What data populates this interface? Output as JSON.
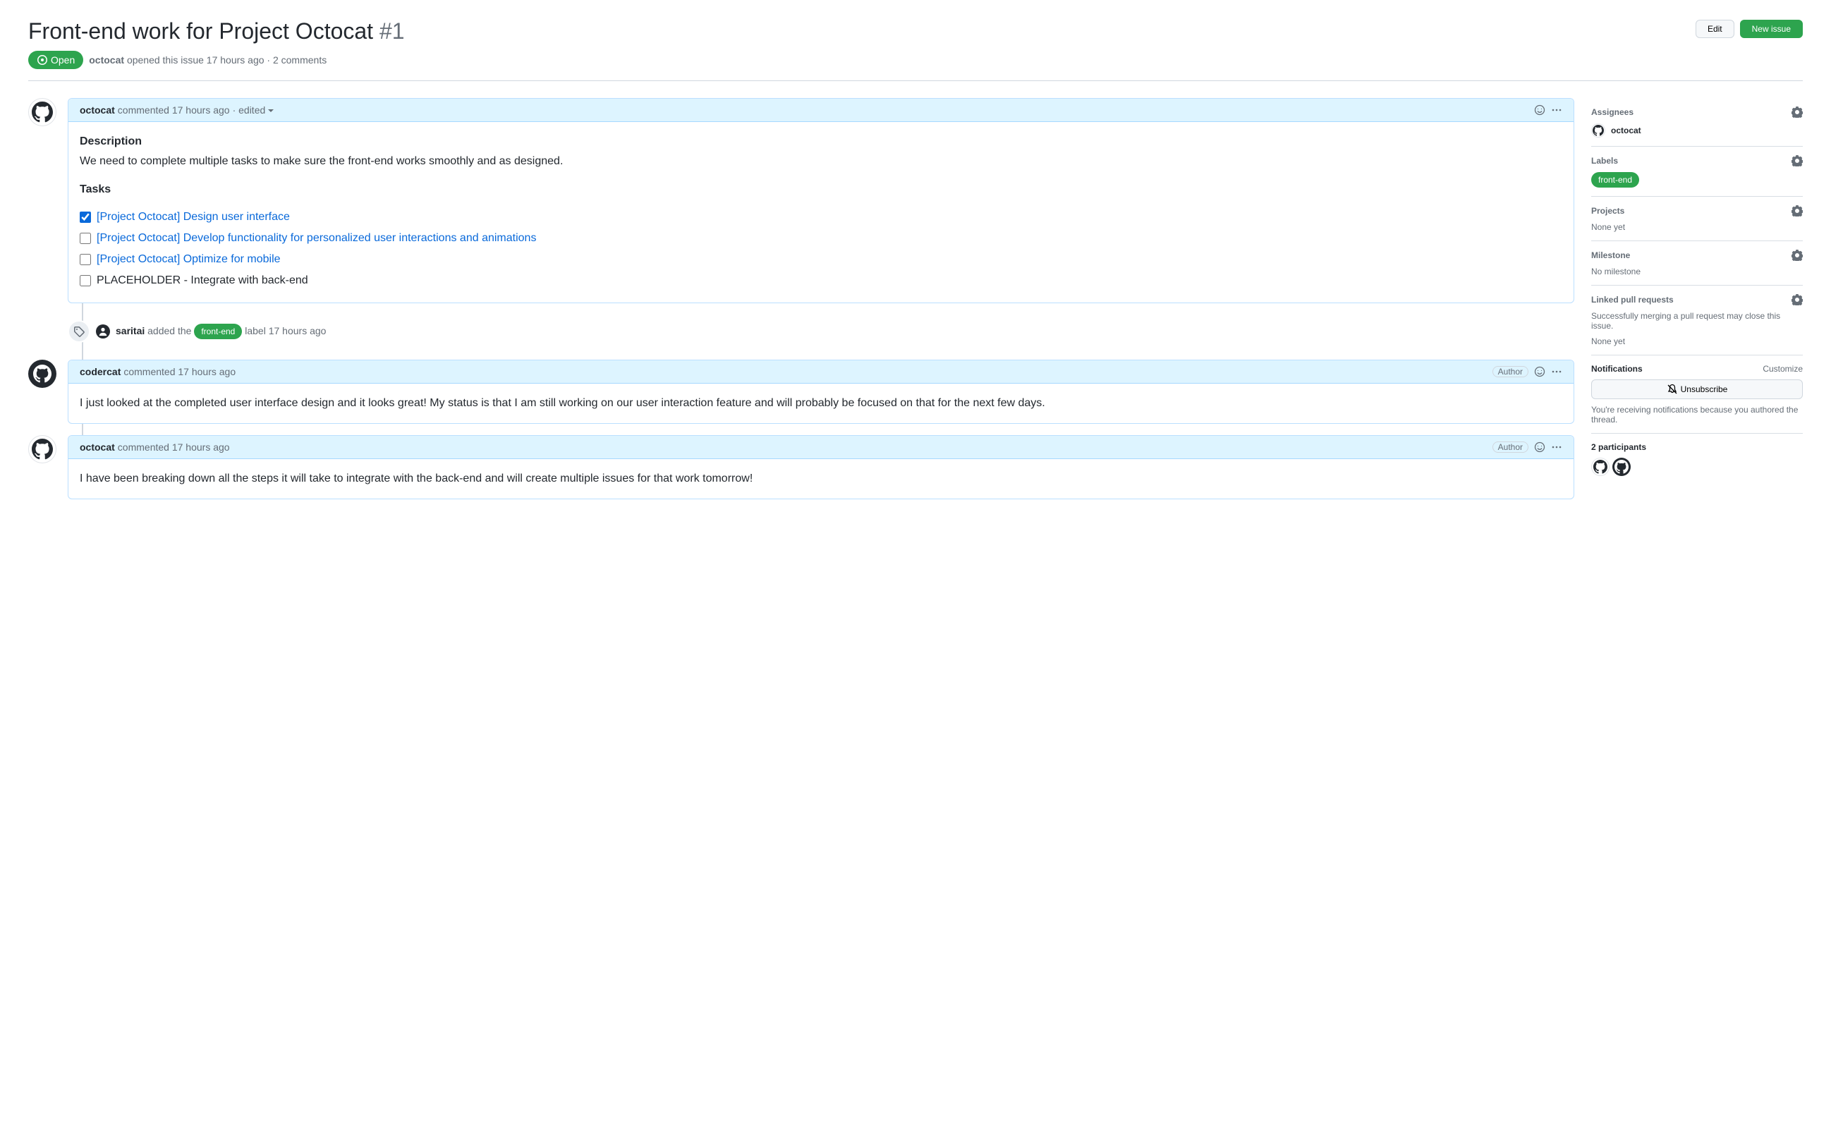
{
  "issue": {
    "title": "Front-end work for Project Octocat",
    "number": "#1",
    "state": "Open",
    "author": "octocat",
    "opened_text": "opened this issue 17 hours ago · 2 comments"
  },
  "actions": {
    "edit": "Edit",
    "new_issue": "New issue"
  },
  "comments": [
    {
      "author": "octocat",
      "timestamp": "commented 17 hours ago",
      "edited": "edited",
      "avatar_type": "octocat",
      "highlight": true,
      "show_author_badge": false,
      "body_type": "tasks",
      "desc_heading": "Description",
      "desc_text": "We need to complete multiple tasks to make sure the front-end works smoothly and as designed.",
      "tasks_heading": "Tasks",
      "tasks": [
        {
          "checked": true,
          "text": "[Project Octocat] Design user interface",
          "link": true
        },
        {
          "checked": false,
          "text": "[Project Octocat] Develop functionality for personalized user interactions and animations",
          "link": true
        },
        {
          "checked": false,
          "text": "[Project Octocat] Optimize for mobile",
          "link": true
        },
        {
          "checked": false,
          "text": "PLACEHOLDER - Integrate with back-end",
          "link": false
        }
      ]
    },
    {
      "author": "codercat",
      "timestamp": "commented 17 hours ago",
      "avatar_type": "codercat",
      "highlight": true,
      "show_author_badge": true,
      "author_badge": "Author",
      "body_type": "text",
      "body_text": "I just looked at the completed user interface design and it looks great! My status is that I am still working on our user interaction feature and will probably be focused on that for the next few days."
    },
    {
      "author": "octocat",
      "timestamp": "commented 17 hours ago",
      "avatar_type": "octocat",
      "highlight": true,
      "show_author_badge": true,
      "author_badge": "Author",
      "body_type": "text",
      "body_text": "I have been breaking down all the steps it will take to integrate with the back-end and will create multiple issues for that work tomorrow!"
    }
  ],
  "event": {
    "actor": "saritai",
    "text_before": "added the",
    "label": "front-end",
    "text_after": "label 17 hours ago"
  },
  "sidebar": {
    "assignees": {
      "title": "Assignees",
      "value": "octocat"
    },
    "labels": {
      "title": "Labels",
      "value": "front-end"
    },
    "projects": {
      "title": "Projects",
      "value": "None yet"
    },
    "milestone": {
      "title": "Milestone",
      "value": "No milestone"
    },
    "linked_prs": {
      "title": "Linked pull requests",
      "desc": "Successfully merging a pull request may close this issue.",
      "value": "None yet"
    },
    "notifications": {
      "title": "Notifications",
      "customize": "Customize",
      "button": "Unsubscribe",
      "reason": "You're receiving notifications because you authored the thread."
    },
    "participants": {
      "title": "2 participants"
    }
  }
}
